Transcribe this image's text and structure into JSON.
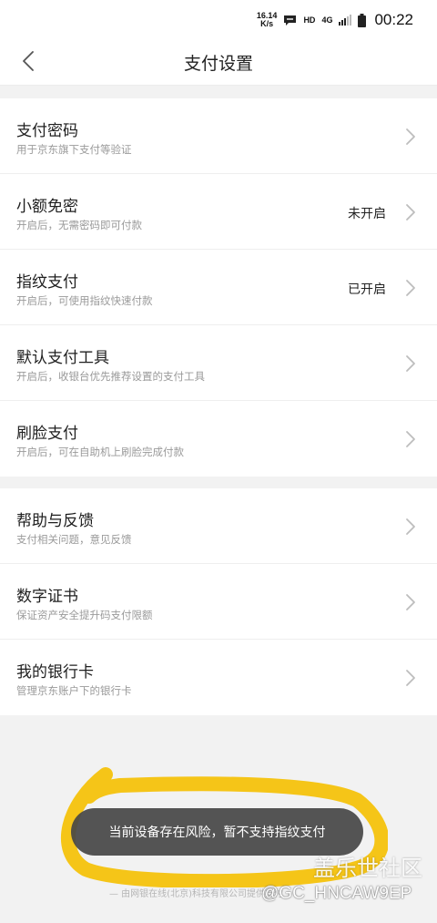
{
  "status_bar": {
    "net_speed_value": "16.14",
    "net_speed_unit": "K/s",
    "hd_label": "HD",
    "network_label": "4G",
    "time": "00:22"
  },
  "header": {
    "back_icon": "chevron-left-icon",
    "title": "支付设置"
  },
  "groups": [
    {
      "items": [
        {
          "title": "支付密码",
          "subtitle": "用于京东旗下支付等验证",
          "status": ""
        },
        {
          "title": "小额免密",
          "subtitle": "开启后，无需密码即可付款",
          "status": "未开启"
        },
        {
          "title": "指纹支付",
          "subtitle": "开启后，可使用指纹快速付款",
          "status": "已开启"
        },
        {
          "title": "默认支付工具",
          "subtitle": "开启后，收银台优先推荐设置的支付工具",
          "status": ""
        },
        {
          "title": "刷脸支付",
          "subtitle": "开启后，可在自助机上刷脸完成付款",
          "status": ""
        }
      ]
    },
    {
      "items": [
        {
          "title": "帮助与反馈",
          "subtitle": "支付相关问题，意见反馈",
          "status": ""
        },
        {
          "title": "数字证书",
          "subtitle": "保证资产安全提升码支付限额",
          "status": ""
        },
        {
          "title": "我的银行卡",
          "subtitle": "管理京东账户下的银行卡",
          "status": ""
        }
      ]
    }
  ],
  "footer": {
    "text": "— 由网银在线(北京)科技有限公司提供支付"
  },
  "toast": {
    "message": "当前设备存在风险，暂不支持指纹支付"
  },
  "annotation": {
    "color": "#f5c518"
  },
  "watermark": {
    "logo_text": "盖乐世社区",
    "user": "@GC_HNCAW9EP"
  },
  "colors": {
    "background": "#f2f2f2",
    "card": "#ffffff",
    "toast": "#464646"
  }
}
